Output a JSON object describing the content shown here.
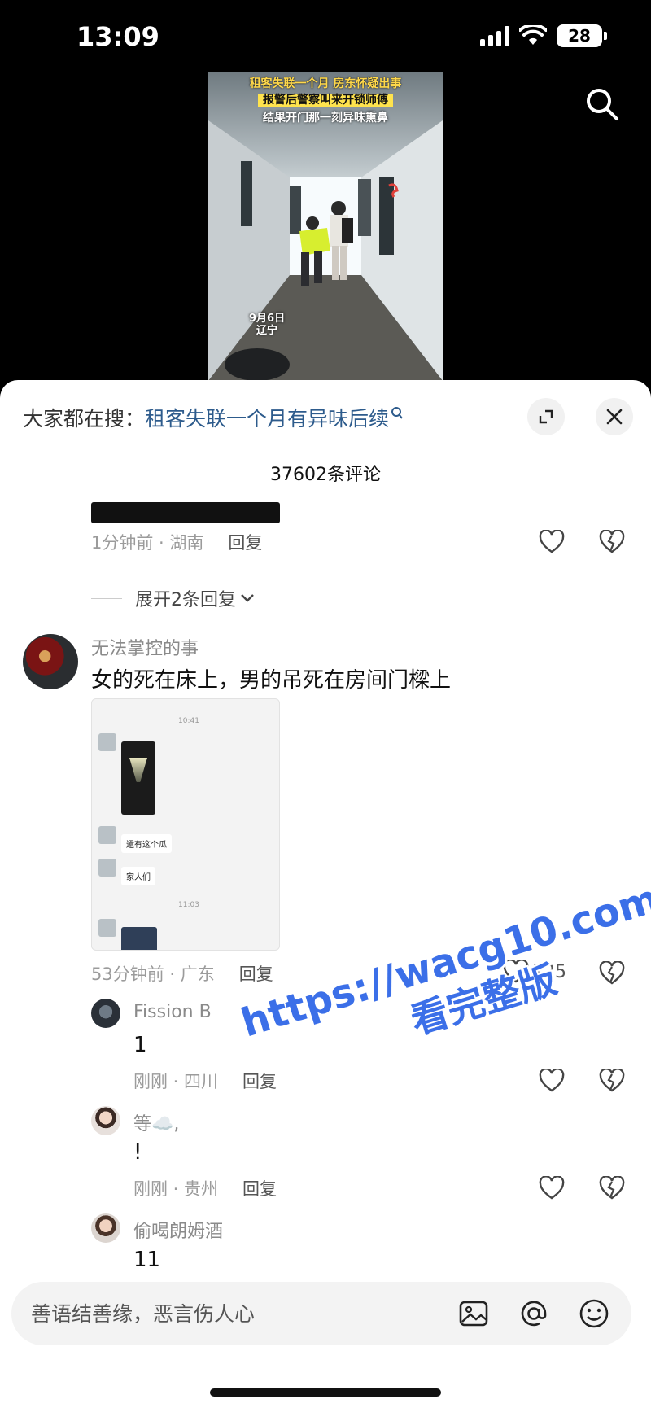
{
  "status": {
    "time": "13:09",
    "battery": "28"
  },
  "video": {
    "caption1": "租客失联一个月 房东怀疑出事",
    "caption2": "报警后警察叫来开锁师傅",
    "caption3": "结果开门那一刻异味熏鼻",
    "date": "9月6日",
    "place": "辽宁"
  },
  "header": {
    "hot_prefix": "大家都在搜：",
    "hot_query": "租客失联一个月有异味后续",
    "comment_count": "37602条评论"
  },
  "prev_comment": {
    "time_loc": "1分钟前 · 湖南",
    "reply": "回复"
  },
  "expand_replies": "展开2条回复",
  "main_comment": {
    "name": "无法掌控的事",
    "text": "女的死在床上，男的吊死在房间门樑上",
    "time_loc": "53分钟前 · 广东",
    "reply": "回复",
    "likes": "125",
    "screenshot": {
      "time1": "10:41",
      "time2": "11:03",
      "msg1": "還有这个瓜",
      "msg2": "家人们"
    }
  },
  "replies": [
    {
      "name": "Fission B",
      "text": "1",
      "time_loc": "刚刚 · 四川",
      "reply": "回复"
    },
    {
      "name": "等☁️,",
      "text": "!",
      "time_loc": "刚刚 · 贵州",
      "reply": "回复"
    },
    {
      "name": "偷喝朗姆酒",
      "text": "11"
    }
  ],
  "watermark": {
    "line1": "https://wacg10.com",
    "line2": "看完整版"
  },
  "input": {
    "placeholder": "善语结善缘，恶言伤人心"
  }
}
